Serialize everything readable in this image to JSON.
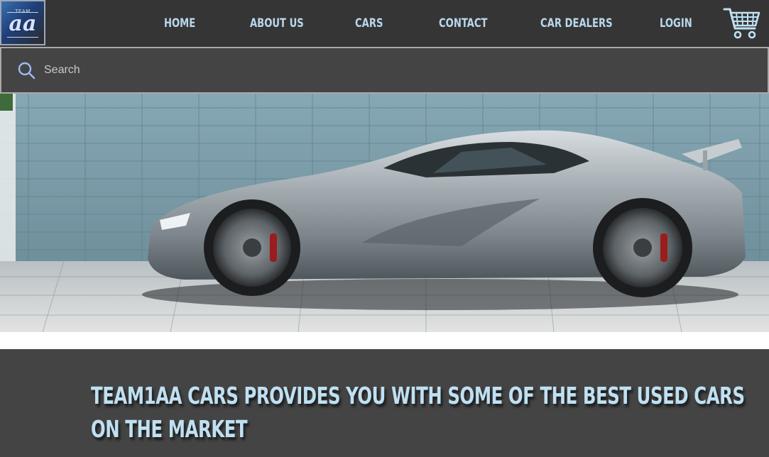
{
  "logo": {
    "top_text": "TEAM",
    "main_text": "aa"
  },
  "nav": {
    "items": [
      {
        "label": "HOME"
      },
      {
        "label": "ABOUT US"
      },
      {
        "label": "CARS"
      },
      {
        "label": "CONTACT"
      },
      {
        "label": "CAR DEALERS"
      },
      {
        "label": "LOGIN"
      }
    ],
    "cart_icon": "shopping-cart-icon"
  },
  "search": {
    "placeholder": "Search",
    "value": "",
    "icon": "search-icon"
  },
  "hero": {
    "image": "silver-sports-car-photo"
  },
  "promo": {
    "headline": "TEAM1AA CARS PROVIDES YOU WITH SOME OF THE BEST USED CARS ON THE MARKET"
  },
  "colors": {
    "nav_background": "#353535",
    "search_background": "#444444",
    "accent_text": "#bfe0f2",
    "promo_background": "#444444"
  }
}
